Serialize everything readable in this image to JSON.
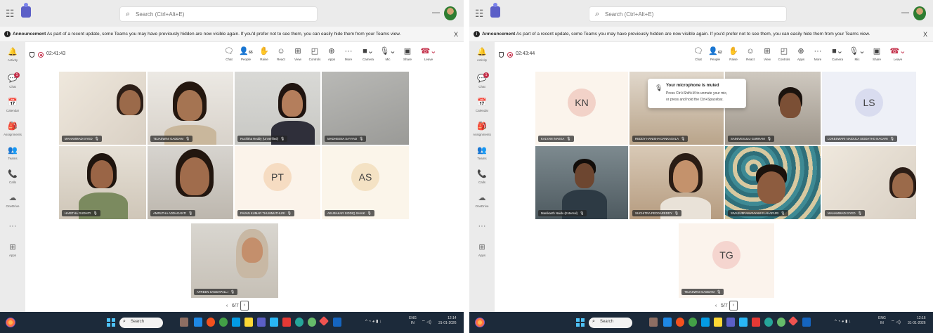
{
  "app": {
    "search_placeholder": "Search (Ctrl+Alt+E)",
    "min_glyph": "—",
    "announcement_title": "Announcement",
    "announcement_text": "As part of a recent update, some Teams you may have previously hidden are now visible again. If you'd prefer not to see them, you can easily hide them from your Teams view.",
    "close_glyph": "X"
  },
  "rail": [
    {
      "label": "Activity",
      "glyph": "🔔"
    },
    {
      "label": "Chat",
      "glyph": "💬",
      "badge": "1"
    },
    {
      "label": "Calendar",
      "glyph": "📅"
    },
    {
      "label": "Assignments",
      "glyph": "🎒"
    },
    {
      "label": "Teams",
      "glyph": "👥"
    },
    {
      "label": "Calls",
      "glyph": "📞"
    },
    {
      "label": "OneDrive",
      "glyph": "☁"
    },
    {
      "label": "",
      "glyph": "···"
    },
    {
      "label": "Apps",
      "glyph": "⊞"
    }
  ],
  "toolbar": {
    "chat": "Chat",
    "people": "People",
    "raise": "Raise",
    "react": "React",
    "view": "View",
    "controls": "Controls",
    "apps": "Apps",
    "more": "More",
    "camera": "Camera",
    "mic": "Mic",
    "share": "Share",
    "leave": "Leave",
    "more_glyph": "···"
  },
  "left": {
    "timer": "02:41:43",
    "people_count": "65",
    "tiles": [
      {
        "name": "MAHAMMADI SYED"
      },
      {
        "name": "TEJASWINI GADDAM"
      },
      {
        "name": "Ruchitha Reddy (Unverified)"
      },
      {
        "name": "MADHEENA SAYYAD"
      },
      {
        "name": "HARITHA GUDHITI"
      },
      {
        "name": "AMRUTHA ADDAGANTI"
      },
      {
        "name": "PAVAN KUMAR THUMMUTHURI",
        "initials": "PT"
      },
      {
        "name": "ABUBAKAR SIDDIQ SHAIK",
        "initials": "AS"
      },
      {
        "name": "AFREEN SADDAPALLI"
      }
    ],
    "pager": "6/7"
  },
  "right": {
    "timer": "02:43:44",
    "people_count": "62",
    "tiles": [
      {
        "name": "KALYANI NAKKA",
        "initials": "KN"
      },
      {
        "name": "REDDY HANISHA DANKASALA"
      },
      {
        "name": "SAINIVESULU GURRAM"
      },
      {
        "name": "LOKESWARI NAIDULA SIDDATHO NAGARI",
        "initials": "LS"
      },
      {
        "name": "Manikanth Naidu (External)"
      },
      {
        "name": "SUCHITRA PEDDAREDDY"
      },
      {
        "name": "SIVASUBRAMANYAM ELAKAPURI"
      },
      {
        "name": "MAHAMMADI SYED"
      },
      {
        "name": "TEJASWINI GADDAM",
        "initials": "TG"
      }
    ],
    "pager": "5/7",
    "toast": {
      "title": "Your microphone is muted",
      "line1": "Press Ctrl+Shift+M to unmute your mic,",
      "line2": "or press and hold the Ctrl+Spacebar."
    }
  },
  "taskbar": {
    "search": "Search",
    "lang": "ENG",
    "lang2": "IN",
    "left_time": "12:14",
    "right_time": "12:16",
    "date": "31-01-2026"
  }
}
